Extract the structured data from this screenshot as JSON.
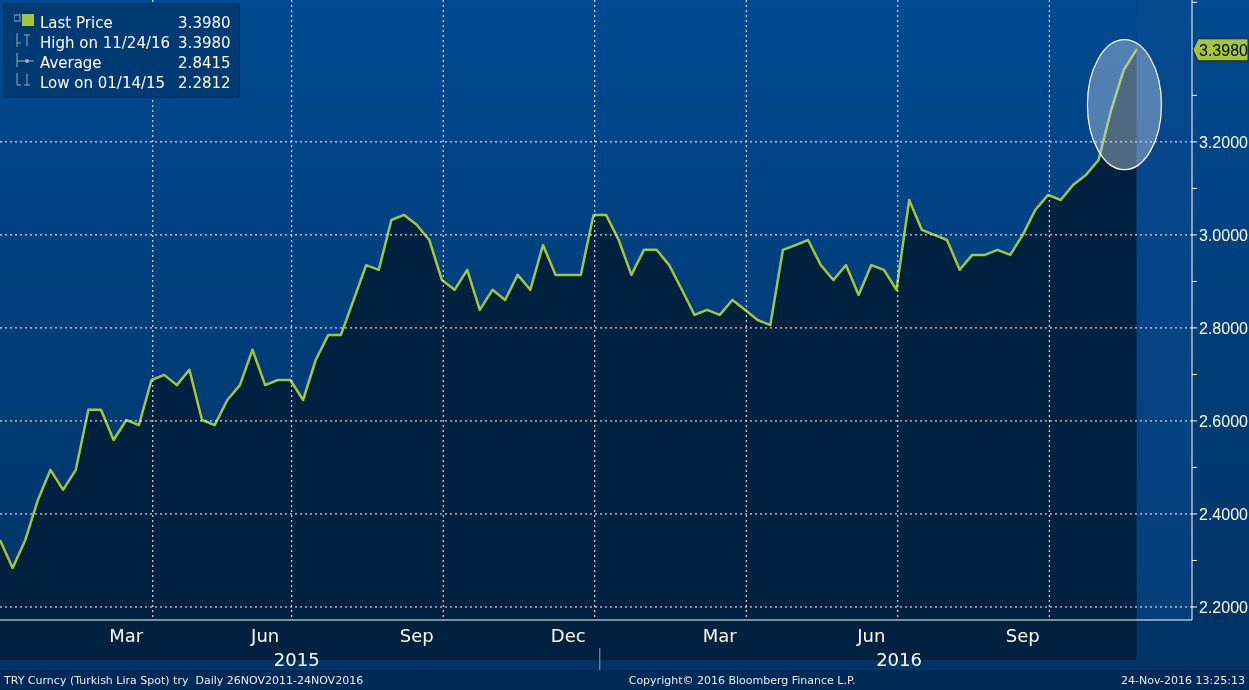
{
  "legend": [
    {
      "kind": "line",
      "value": "3.3980"
    },
    {
      "kind": "high",
      "label": "High on 11/24/16",
      "value": "3.3980"
    },
    {
      "kind": "average",
      "label": "Average",
      "value": "2.8415"
    },
    {
      "kind": "low",
      "label": "Low on 01/14/15",
      "value": "2.2812"
    }
  ],
  "chart": {
    "chart_data": {
      "type": "area",
      "ylim": [
        2.172,
        3.505
      ],
      "categories": [
        null,
        null,
        null,
        null,
        null,
        null,
        null,
        null,
        null,
        null,
        "Mar",
        null,
        null,
        null,
        null,
        null,
        null,
        null,
        null,
        null,
        null,
        "Jun",
        null,
        null,
        null,
        null,
        null,
        null,
        null,
        null,
        null,
        null,
        null,
        "Sep",
        null,
        null,
        null,
        null,
        null,
        null,
        null,
        null,
        null,
        null,
        null,
        "Dec",
        null,
        null,
        null,
        null,
        null,
        null,
        null,
        null,
        null,
        null,
        null,
        "Mar",
        null,
        null,
        null,
        null,
        null,
        null,
        null,
        null,
        null,
        null,
        null,
        "Jun",
        null,
        null,
        null,
        null,
        null,
        null,
        null,
        null,
        null,
        null,
        null,
        "Sep",
        null,
        null,
        null,
        null,
        null,
        null,
        null,
        null,
        null
      ],
      "series": [
        {
          "name": "Last Price",
          "color": "#a4c639",
          "values": [
            2.344,
            2.284,
            2.344,
            2.43,
            2.495,
            2.452,
            2.495,
            2.624,
            2.624,
            2.559,
            2.602,
            2.591,
            2.688,
            2.699,
            2.677,
            2.71,
            2.602,
            2.591,
            2.645,
            2.677,
            2.753,
            2.677,
            2.688,
            2.688,
            2.645,
            2.731,
            2.785,
            2.785,
            2.86,
            2.935,
            2.925,
            3.032,
            3.043,
            3.022,
            2.989,
            2.903,
            2.882,
            2.925,
            2.839,
            2.882,
            2.86,
            2.914,
            2.882,
            2.978,
            2.914,
            2.914,
            2.914,
            3.043,
            3.043,
            2.989,
            2.914,
            2.968,
            2.968,
            2.935,
            2.882,
            2.828,
            2.839,
            2.828,
            2.86,
            2.839,
            2.817,
            2.806,
            2.968,
            2.978,
            2.989,
            2.935,
            2.903,
            2.935,
            2.871,
            2.935,
            2.925,
            2.882,
            3.075,
            3.011,
            3.0,
            2.989,
            2.925,
            2.957,
            2.957,
            2.968,
            2.957,
            3.0,
            3.054,
            3.086,
            3.075,
            3.108,
            3.129,
            3.161,
            3.269,
            3.355,
            3.398
          ]
        }
      ],
      "yticks": [
        {
          "value": 2.2,
          "label": "2.2000"
        },
        {
          "value": 2.4,
          "label": "2.4000"
        },
        {
          "value": 2.6,
          "label": "2.6000"
        },
        {
          "value": 2.8,
          "label": "2.8000"
        },
        {
          "value": 3.0,
          "label": "3.0000"
        },
        {
          "value": 3.2,
          "label": "3.2000"
        }
      ],
      "grid": true
    },
    "year_labels": [
      "2015",
      "2016"
    ],
    "price_tag": "3.3980"
  },
  "footer": {
    "left": "TRY Curncy (Turkish Lira Spot) try  Daily 26NOV2011-24NOV2016",
    "center": "Copyright© 2016 Bloomberg Finance L.P.",
    "right": "24-Nov-2016 13:25:13"
  }
}
